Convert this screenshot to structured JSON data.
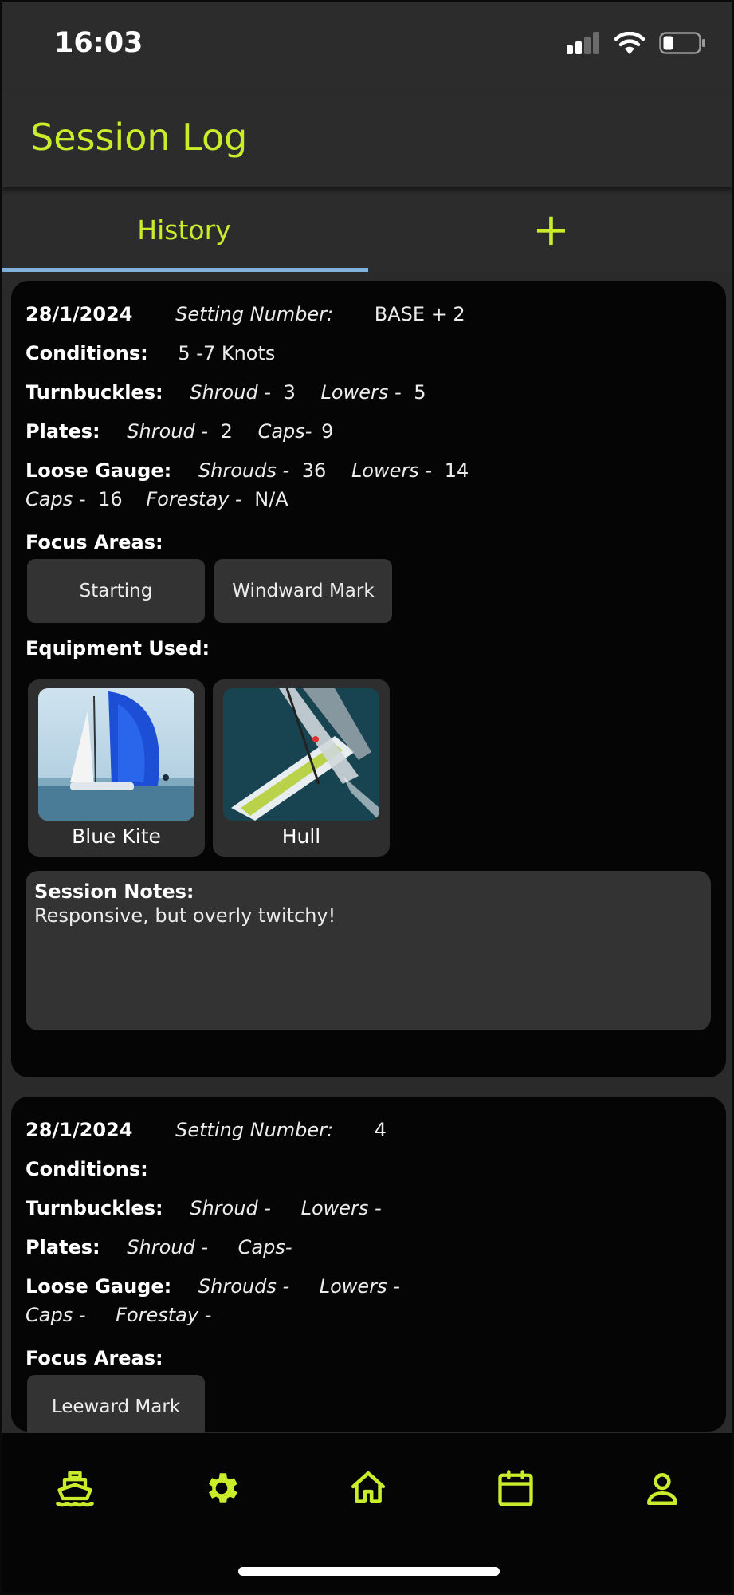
{
  "status_bar": {
    "time": "16:03"
  },
  "header": {
    "title": "Session Log"
  },
  "tabs": {
    "history_label": "History",
    "add_label": "+"
  },
  "sessions": [
    {
      "date": "28/1/2024",
      "setting_label": "Setting Number:",
      "setting_value": "BASE + 2",
      "conditions_label": "Conditions:",
      "conditions_value": "5 -7 Knots",
      "turnbuckles_label": "Turnbuckles:",
      "turnbuckles_shroud_label": "Shroud -",
      "turnbuckles_shroud_value": "3",
      "turnbuckles_lowers_label": "Lowers -",
      "turnbuckles_lowers_value": "5",
      "plates_label": "Plates:",
      "plates_shroud_label": "Shroud -",
      "plates_shroud_value": "2",
      "plates_caps_label": "Caps-",
      "plates_caps_value": "9",
      "loose_gauge_label": "Loose Gauge:",
      "lg_shrouds_label": "Shrouds -",
      "lg_shrouds_value": "36",
      "lg_lowers_label": "Lowers -",
      "lg_lowers_value": "14",
      "lg_caps_label": "Caps -",
      "lg_caps_value": "16",
      "lg_forestay_label": "Forestay -",
      "lg_forestay_value": "N/A",
      "focus_label": "Focus Areas:",
      "focus_areas": [
        "Starting",
        "Windward Mark"
      ],
      "equipment_label": "Equipment Used:",
      "equipment": [
        {
          "name": "Blue Kite"
        },
        {
          "name": "Hull"
        }
      ],
      "notes_label": "Session Notes:",
      "notes_text": "Responsive, but overly twitchy!"
    },
    {
      "date": "28/1/2024",
      "setting_label": "Setting Number:",
      "setting_value": "4",
      "conditions_label": "Conditions:",
      "turnbuckles_label": "Turnbuckles:",
      "turnbuckles_shroud_label": "Shroud -",
      "turnbuckles_lowers_label": "Lowers -",
      "plates_label": "Plates:",
      "plates_shroud_label": "Shroud -",
      "plates_caps_label": "Caps-",
      "loose_gauge_label": "Loose Gauge:",
      "lg_shrouds_label": "Shrouds -",
      "lg_lowers_label": "Lowers -",
      "lg_caps_label": "Caps -",
      "lg_forestay_label": "Forestay -",
      "focus_label": "Focus Areas:",
      "focus_areas": [
        "Leeward Mark"
      ]
    }
  ],
  "bottom_nav": {
    "items": [
      {
        "icon": "boat-icon"
      },
      {
        "icon": "gear-icon"
      },
      {
        "icon": "home-icon"
      },
      {
        "icon": "calendar-icon"
      },
      {
        "icon": "profile-icon"
      }
    ]
  },
  "colors": {
    "accent": "#c9ec2b",
    "tab_indicator": "#7eb2dd",
    "card": "#050505",
    "chip": "#333333"
  }
}
